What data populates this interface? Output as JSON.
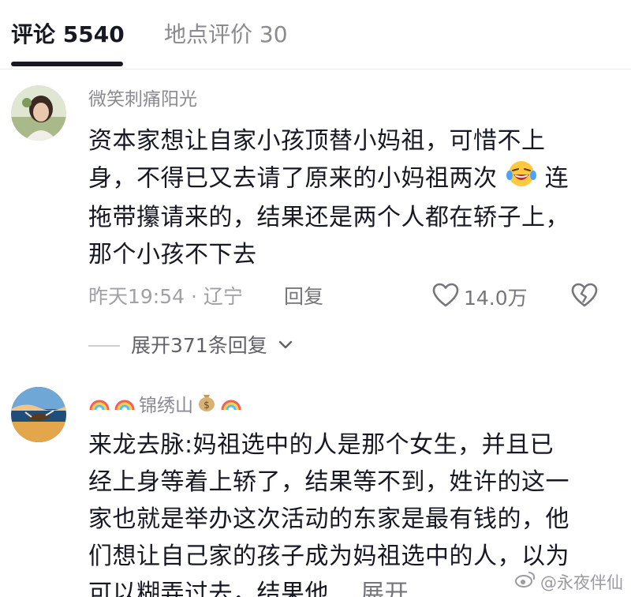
{
  "tabs": [
    {
      "label": "评论 5540"
    },
    {
      "label": "地点评价 30"
    }
  ],
  "comments": [
    {
      "username": "微笑刺痛阳光",
      "lines": [
        "资本家想让自家小孩顶替小妈祖，可惜不上",
        "身，不得已又去请了原来的小妈祖两次",
        "连",
        "拖带攥请来的，结果还是两个人都在轿子上，",
        "那个小孩不下去"
      ],
      "time": "昨天19:54 · 辽宁",
      "reply_label": "回复",
      "likes": "14.0万",
      "expand_label": "展开371条回复"
    },
    {
      "username": "锦绣山",
      "lines": [
        "来龙去脉:妈祖选中的人是那个女生，并且已",
        "经上身等着上轿了，结果等不到，姓许的这一",
        "家也就是举办这次活动的东家是最有钱的，他",
        "们想让自己家的孩子成为妈祖选中的人，以为",
        "可以糊弄过去，结果他..."
      ],
      "more_label": "展开"
    }
  ],
  "watermark": {
    "text": "@永夜伴仙"
  },
  "colors": {
    "primary_text": "#161823",
    "secondary_text": "#8a8b91",
    "divider": "#ececec"
  }
}
